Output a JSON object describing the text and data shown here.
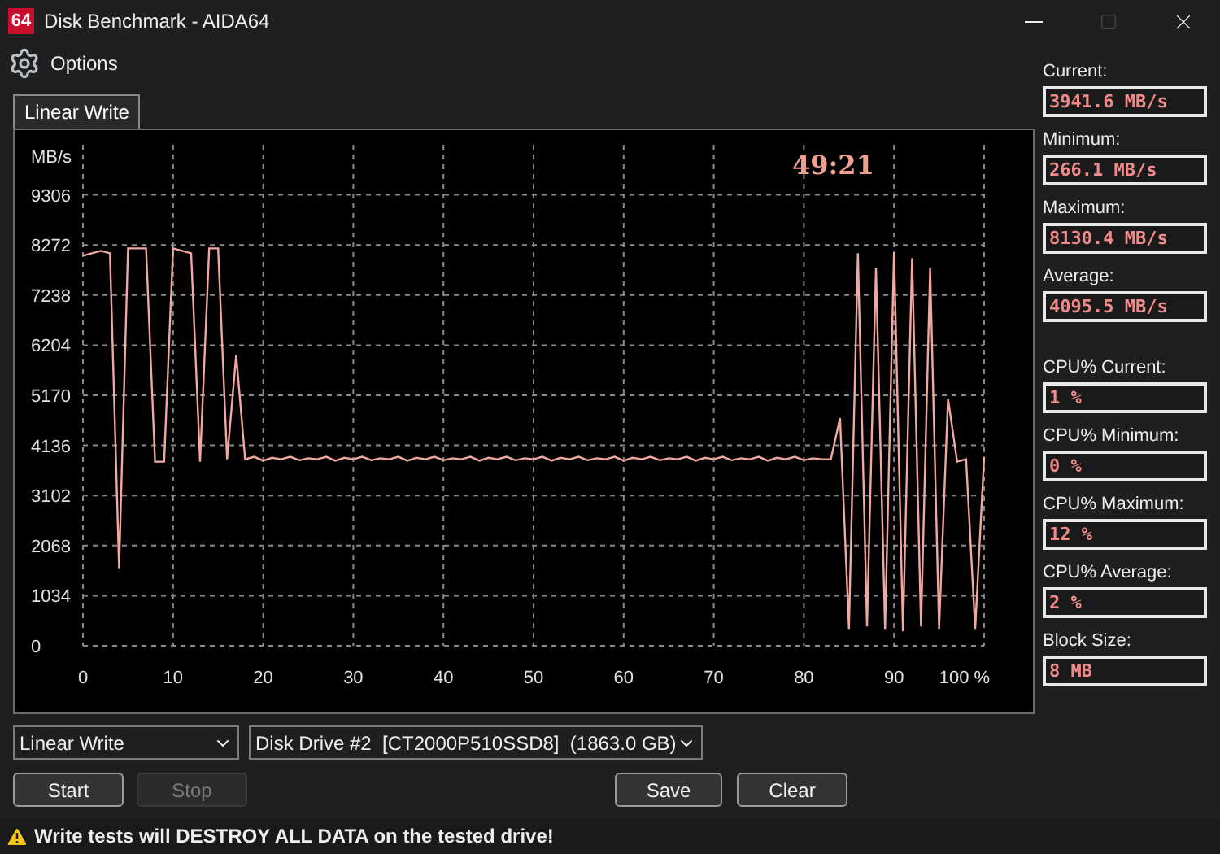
{
  "window": {
    "app_icon_text": "64",
    "title": "Disk Benchmark - AIDA64",
    "maximize_disabled": true
  },
  "toolbar": {
    "options_label": "Options"
  },
  "tabs": [
    {
      "label": "Linear Write",
      "selected": true
    }
  ],
  "chart": {
    "timer": "49:21",
    "chart_data": {
      "type": "line",
      "ylabel": "MB/s",
      "grid": true,
      "xlim": [
        0,
        100
      ],
      "ylim": [
        0,
        10340
      ],
      "x": [
        0,
        1,
        2,
        3,
        4,
        5,
        6,
        7,
        8,
        9,
        10,
        11,
        12,
        13,
        14,
        15,
        16,
        17,
        18,
        19,
        20,
        21,
        22,
        23,
        24,
        25,
        26,
        27,
        28,
        29,
        30,
        31,
        32,
        33,
        34,
        35,
        36,
        37,
        38,
        39,
        40,
        41,
        42,
        43,
        44,
        45,
        46,
        47,
        48,
        49,
        50,
        51,
        52,
        53,
        54,
        55,
        56,
        57,
        58,
        59,
        60,
        61,
        62,
        63,
        64,
        65,
        66,
        67,
        68,
        69,
        70,
        71,
        72,
        73,
        74,
        75,
        76,
        77,
        78,
        79,
        80,
        81,
        82,
        83,
        84,
        85,
        86,
        87,
        88,
        89,
        90,
        91,
        92,
        93,
        94,
        95,
        96,
        97,
        98,
        99,
        100
      ],
      "xticks": [
        0,
        10,
        20,
        30,
        40,
        50,
        60,
        70,
        80,
        90,
        {
          "value": 100,
          "label": "100 %"
        }
      ],
      "yticks": [
        0,
        1034,
        2068,
        3102,
        4136,
        5170,
        6204,
        7238,
        8272,
        9306
      ],
      "series": [
        {
          "color": "#f0a8a0",
          "values": [
            8050,
            8100,
            8150,
            8100,
            1600,
            8200,
            8200,
            8200,
            3800,
            3800,
            8200,
            8150,
            8100,
            3800,
            8200,
            8200,
            3850,
            6000,
            3850,
            3900,
            3820,
            3880,
            3850,
            3900,
            3830,
            3870,
            3850,
            3900,
            3820,
            3880,
            3850,
            3900,
            3830,
            3870,
            3850,
            3900,
            3820,
            3880,
            3850,
            3900,
            3830,
            3870,
            3850,
            3900,
            3820,
            3880,
            3850,
            3900,
            3830,
            3870,
            3850,
            3900,
            3820,
            3880,
            3850,
            3900,
            3830,
            3870,
            3850,
            3900,
            3820,
            3880,
            3850,
            3900,
            3830,
            3870,
            3850,
            3900,
            3820,
            3880,
            3850,
            3900,
            3830,
            3870,
            3850,
            3900,
            3820,
            3880,
            3850,
            3900,
            3830,
            3870,
            3850,
            3850,
            4700,
            350,
            8100,
            400,
            7800,
            350,
            8130,
            300,
            8000,
            400,
            7800,
            350,
            5100,
            3800,
            3850,
            350,
            3900
          ]
        }
      ]
    }
  },
  "stats": [
    {
      "label": "Current:",
      "value": "3941.6 MB/s"
    },
    {
      "label": "Minimum:",
      "value": "266.1 MB/s"
    },
    {
      "label": "Maximum:",
      "value": "8130.4 MB/s"
    },
    {
      "label": "Average:",
      "value": "4095.5 MB/s"
    },
    {
      "label": "CPU% Current:",
      "value": "1 %"
    },
    {
      "label": "CPU% Minimum:",
      "value": "0 %"
    },
    {
      "label": "CPU% Maximum:",
      "value": "12 %"
    },
    {
      "label": "CPU% Average:",
      "value": "2 %"
    },
    {
      "label": "Block Size:",
      "value": "8 MB"
    }
  ],
  "controls": {
    "test_select": "Linear Write",
    "drive_select": "Disk Drive #2  [CT2000P510SSD8]  (1863.0 GB)"
  },
  "buttons": [
    {
      "label": "Start",
      "disabled": false
    },
    {
      "label": "Stop",
      "disabled": true
    },
    {
      "label": "Save",
      "disabled": false
    },
    {
      "label": "Clear",
      "disabled": false
    }
  ],
  "warning": "Write tests will DESTROY ALL DATA on the tested drive!"
}
